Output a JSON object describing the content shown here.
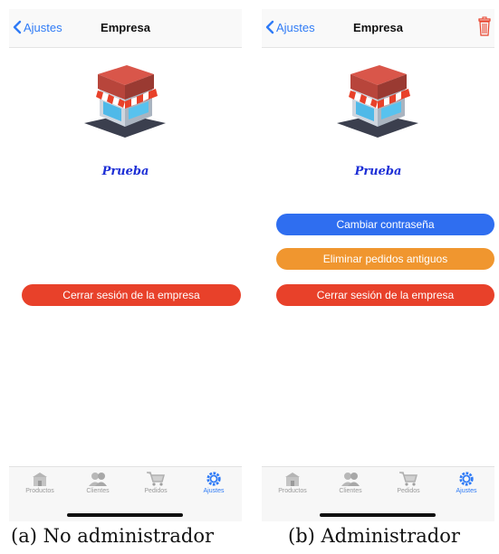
{
  "nav": {
    "back_label": "Ajustes",
    "title": "Empresa"
  },
  "company_name": "Prueba",
  "panel_a": {
    "buttons": {
      "logout": "Cerrar sesión de la empresa"
    }
  },
  "panel_b": {
    "buttons": {
      "change_password": "Cambiar contraseña",
      "delete_old_orders": "Eliminar pedidos antiguos",
      "logout": "Cerrar sesión de la empresa"
    }
  },
  "tabs": [
    {
      "label": "Productos",
      "icon": "store-icon"
    },
    {
      "label": "Clientes",
      "icon": "clients-icon"
    },
    {
      "label": "Pedidos",
      "icon": "cart-icon"
    },
    {
      "label": "Ajustes",
      "icon": "gear-icon",
      "active": true
    }
  ],
  "captions": {
    "a": "(a) No administrador",
    "b": "(b) Administrador"
  },
  "colors": {
    "accent": "#2f7bf6",
    "red": "#e8412a",
    "blue": "#2f6ef0",
    "orange": "#f0962f",
    "company_name": "#1d2fd6"
  }
}
